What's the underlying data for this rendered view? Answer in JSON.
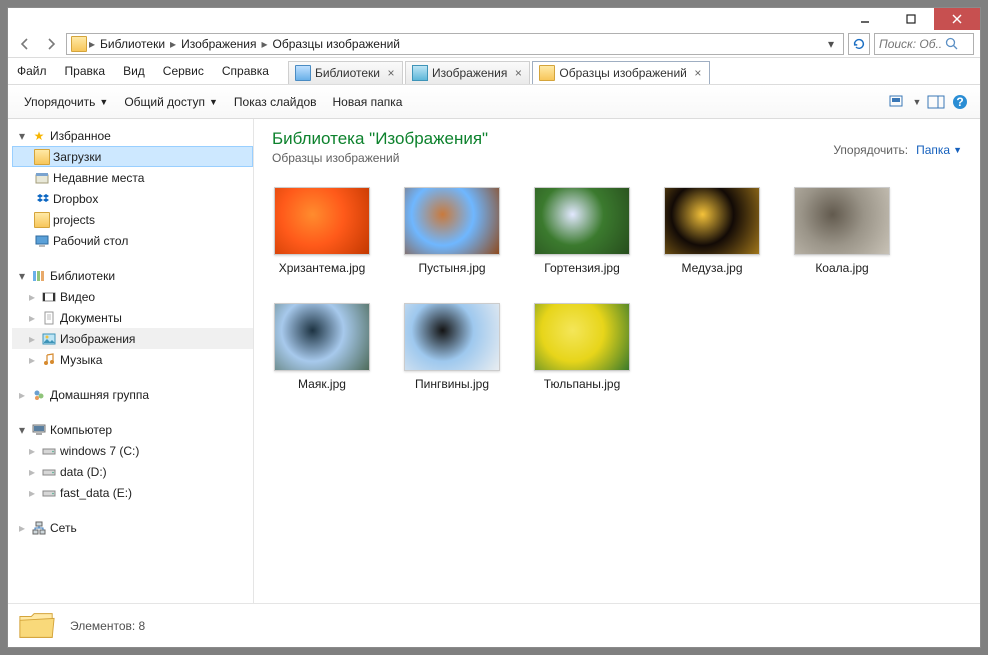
{
  "titlebar": {
    "minimize": "—",
    "maximize": "□",
    "close": "✕"
  },
  "nav": {
    "crumbs": [
      "Библиотеки",
      "Изображения",
      "Образцы изображений"
    ],
    "search_placeholder": "Поиск: Об..."
  },
  "menu": {
    "items": [
      "Файл",
      "Правка",
      "Вид",
      "Сервис",
      "Справка"
    ],
    "tabs": [
      {
        "label": "Библиотеки",
        "active": false
      },
      {
        "label": "Изображения",
        "active": false
      },
      {
        "label": "Образцы изображений",
        "active": true
      }
    ]
  },
  "toolbar": {
    "organize": "Упорядочить",
    "share": "Общий доступ",
    "slideshow": "Показ слайдов",
    "newfolder": "Новая папка"
  },
  "sidebar": {
    "favorites": {
      "label": "Избранное",
      "items": [
        "Загрузки",
        "Недавние места",
        "Dropbox",
        "projects",
        "Рабочий стол"
      ]
    },
    "libraries": {
      "label": "Библиотеки",
      "items": [
        "Видео",
        "Документы",
        "Изображения",
        "Музыка"
      ]
    },
    "homegroup": {
      "label": "Домашняя группа"
    },
    "computer": {
      "label": "Компьютер",
      "items": [
        "windows 7 (C:)",
        "data (D:)",
        "fast_data (E:)"
      ]
    },
    "network": {
      "label": "Сеть"
    }
  },
  "content": {
    "library_title": "Библиотека \"Изображения\"",
    "library_sub": "Образцы изображений",
    "arrange_label": "Упорядочить:",
    "arrange_value": "Папка",
    "files": [
      {
        "name": "Хризантема.jpg",
        "colors": [
          "#ff5a1a",
          "#ff8c2e",
          "#c23800"
        ]
      },
      {
        "name": "Пустыня.jpg",
        "colors": [
          "#6fb7ff",
          "#c97a3d",
          "#8e4a1e"
        ]
      },
      {
        "name": "Гортензия.jpg",
        "colors": [
          "#3b7a2e",
          "#e2e8ff",
          "#274d1d"
        ]
      },
      {
        "name": "Медуза.jpg",
        "colors": [
          "#120a06",
          "#f4c23a",
          "#a0761a"
        ]
      },
      {
        "name": "Коала.jpg",
        "colors": [
          "#9a9488",
          "#625a4e",
          "#c8c2b6"
        ]
      },
      {
        "name": "Маяк.jpg",
        "colors": [
          "#a7c9ec",
          "#1d3342",
          "#4e6b5a"
        ]
      },
      {
        "name": "Пингвины.jpg",
        "colors": [
          "#9ec8ee",
          "#141414",
          "#e9edf1"
        ]
      },
      {
        "name": "Тюльпаны.jpg",
        "colors": [
          "#e7d51a",
          "#f4e659",
          "#3a7a2b"
        ]
      }
    ]
  },
  "status": {
    "count_label": "Элементов: 8"
  }
}
